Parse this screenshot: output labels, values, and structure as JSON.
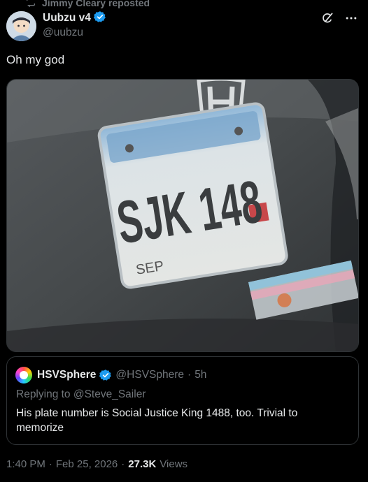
{
  "repost": {
    "label": "Jimmy Cleary reposted",
    "icon": "repost-icon"
  },
  "author": {
    "name": "Uubzu v4",
    "handle": "@uubzu",
    "verified_color": "#1d9bf0"
  },
  "icons": {
    "grok": "grok-icon",
    "more": "more-icon"
  },
  "tweet": {
    "text": "Oh my god"
  },
  "media": {
    "plate_text": "SJK 148",
    "plate_month": "SEP"
  },
  "quote": {
    "name": "HSVSphere",
    "handle": "@HSVSphere",
    "separator": "·",
    "time": "5h",
    "replying_to": "Replying to @Steve_Sailer",
    "text": "His plate number is Social Justice King 1488, too. Trivial to memorize"
  },
  "meta": {
    "time": "1:40 PM",
    "sep1": "·",
    "date": "Feb 25, 2026",
    "sep2": "·",
    "views_count": "27.3K",
    "views_label": "Views"
  },
  "colors": {
    "background": "#000000",
    "text": "#e7e9ea",
    "muted": "#71767b",
    "border": "#2f3336"
  }
}
